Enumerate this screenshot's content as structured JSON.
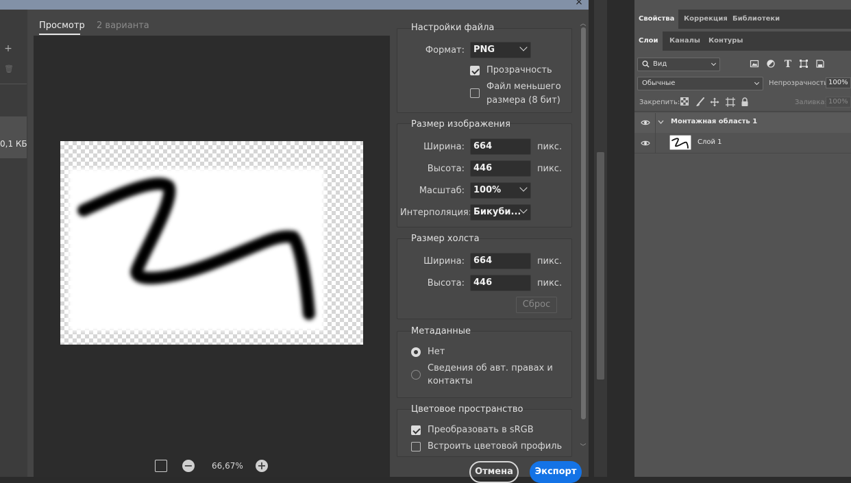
{
  "dialog": {
    "close_glyph": "×",
    "tabs": {
      "preview": "Просмотр",
      "variants": "2 варианта"
    },
    "left_strip": {
      "add_glyph": "+",
      "delete_glyph": "🗑",
      "file_size": "0,1 КБ"
    },
    "zoom": {
      "value": "66,67%",
      "minus": "−",
      "plus": "+"
    },
    "file_settings": {
      "title": "Настройки файла",
      "format_label": "Формат:",
      "format_value": "PNG",
      "transparency_label": "Прозрачность",
      "transparency_checked": true,
      "smaller_file_label_1": "Файл меньшего",
      "smaller_file_label_2": "размера (8 бит)",
      "smaller_file_checked": false
    },
    "image_size": {
      "title": "Размер изображения",
      "width_label": "Ширина:",
      "width_value": "664",
      "width_unit": "пикс.",
      "height_label": "Высота:",
      "height_value": "446",
      "height_unit": "пикс.",
      "scale_label": "Масштаб:",
      "scale_value": "100%",
      "interp_label": "Интерполяция:",
      "interp_value": "Бикуби..."
    },
    "canvas_size": {
      "title": "Размер холста",
      "width_label": "Ширина:",
      "width_value": "664",
      "width_unit": "пикс.",
      "height_label": "Высота:",
      "height_value": "446",
      "height_unit": "пикс.",
      "reset_label": "Сброс"
    },
    "metadata": {
      "title": "Метаданные",
      "option_none": "Нет",
      "option_copyright_1": "Сведения об авт. правах и",
      "option_copyright_2": "контакты",
      "selected": "none"
    },
    "color_space": {
      "title": "Цветовое пространство",
      "convert_label": "Преобразовать в sRGB",
      "convert_checked": true,
      "embed_label": "Встроить цветовой профиль",
      "embed_checked": false
    },
    "buttons": {
      "cancel": "Отмена",
      "export": "Экспорт"
    },
    "colors": {
      "export_button": "#1473e6",
      "titlebar": "#8291a7"
    }
  },
  "panel": {
    "tabs_top": [
      "Свойства",
      "Коррекция",
      "Библиотеки"
    ],
    "tabs_layers": [
      "Слои",
      "Каналы",
      "Контуры"
    ],
    "filter_kind": "Вид",
    "blend_mode": "Обычные",
    "opacity_label": "Непрозрачность:",
    "opacity_value": "100%",
    "lock_label": "Закрепить:",
    "fill_label": "Заливка:",
    "fill_value": "100%",
    "layers": [
      {
        "name": "Монтажная область 1",
        "kind": "artboard"
      },
      {
        "name": "Слой 1",
        "kind": "layer"
      }
    ]
  }
}
